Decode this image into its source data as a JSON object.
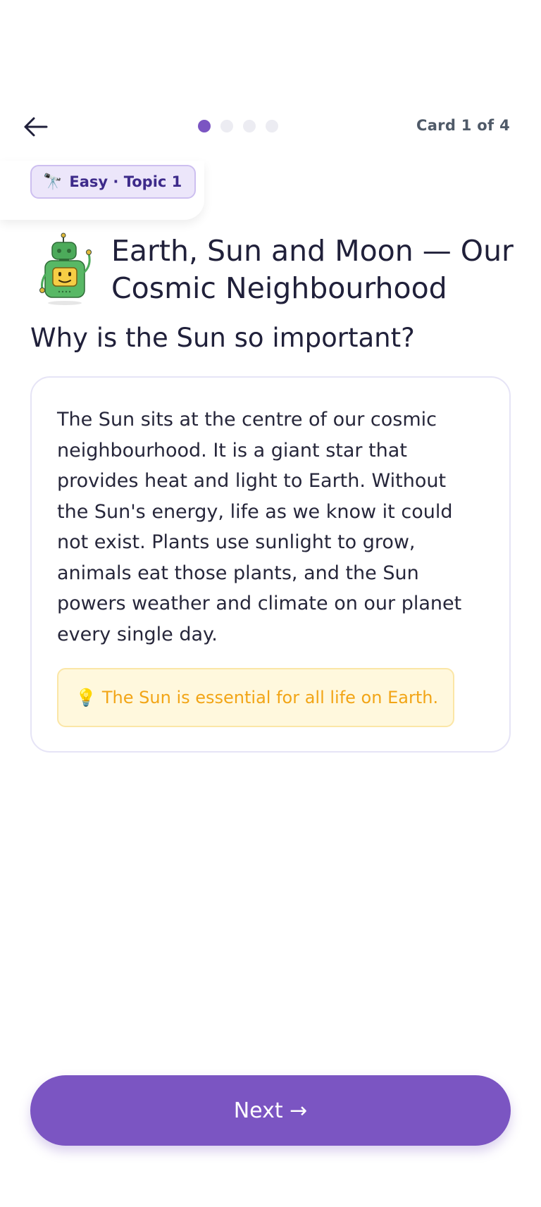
{
  "header": {
    "back_icon": "arrow-left-icon",
    "progress": {
      "total": 4,
      "current": 1
    },
    "card_count": "Card 1 of 4"
  },
  "badge": {
    "emoji": "🔭",
    "label": "Easy · Topic 1"
  },
  "lesson": {
    "mascot_icon": "robot-icon",
    "title": "Earth, Sun and Moon — Our Cosmic Neighbourhood",
    "question": "Why is the Sun so important?",
    "body": "The Sun sits at the centre of our cosmic neighbourhood. It is a giant star that provides heat and light to Earth. Without the Sun's energy, life as we know it could not exist. Plants use sunlight to grow, animals eat those plants, and the Sun powers weather and climate on our planet every single day.",
    "tip_emoji": "💡",
    "tip": "The Sun is essential for all life on Earth."
  },
  "footer": {
    "next_label": "Next →"
  },
  "colors": {
    "accent": "#7b55c2",
    "badge_bg": "#ece6fa",
    "tip_text": "#f2a516",
    "tip_bg": "#fff8dd"
  }
}
